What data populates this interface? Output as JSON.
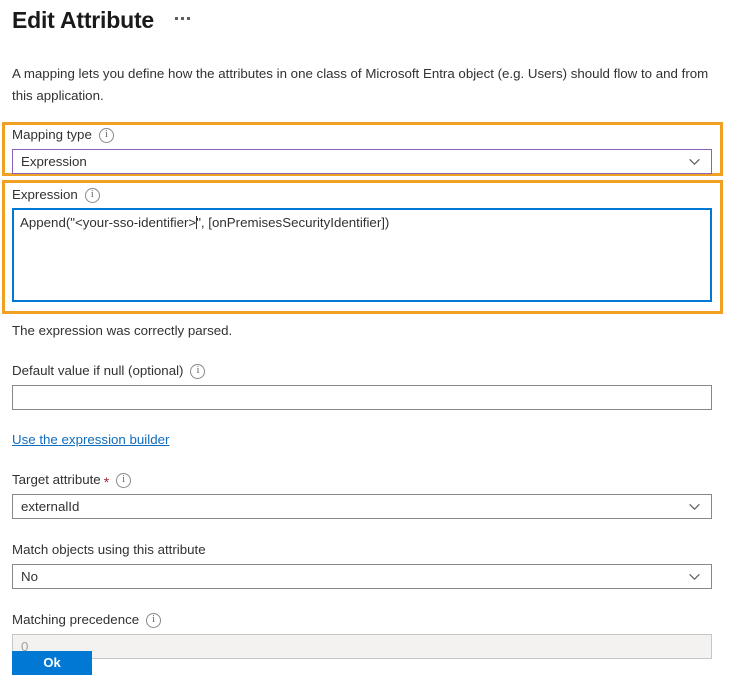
{
  "header": {
    "title": "Edit Attribute",
    "more_menu": "…"
  },
  "description": "A mapping lets you define how the attributes in one class of Microsoft Entra object (e.g. Users) should flow to and from this application.",
  "mapping_type": {
    "label": "Mapping type",
    "value": "Expression",
    "info_tooltip": "info"
  },
  "expression": {
    "label": "Expression",
    "value_before_caret": "Append(\"<your-sso-identifier>",
    "value_after_caret": "\", [onPremisesSecurityIdentifier])",
    "full_value": "Append(\"<your-sso-identifier>\", [onPremisesSecurityIdentifier])",
    "validation_message": "The expression was correctly parsed."
  },
  "default_value": {
    "label": "Default value if null (optional)",
    "value": "",
    "placeholder": ""
  },
  "expression_builder_link": "Use the expression builder",
  "target_attribute": {
    "label": "Target attribute",
    "required_marker": "*",
    "value": "externalId"
  },
  "match_objects": {
    "label": "Match objects using this attribute",
    "value": "No"
  },
  "matching_precedence": {
    "label": "Matching precedence",
    "value": "0",
    "disabled": true
  },
  "footer": {
    "ok_label": "Ok"
  },
  "colors": {
    "highlight": "#f0a022",
    "focus_border": "#0078d4",
    "select_border": "#8764b8",
    "primary_button": "#0078d4",
    "link": "#0f6cbd",
    "required": "#a4262c",
    "disabled_bg": "#f3f2f1"
  }
}
